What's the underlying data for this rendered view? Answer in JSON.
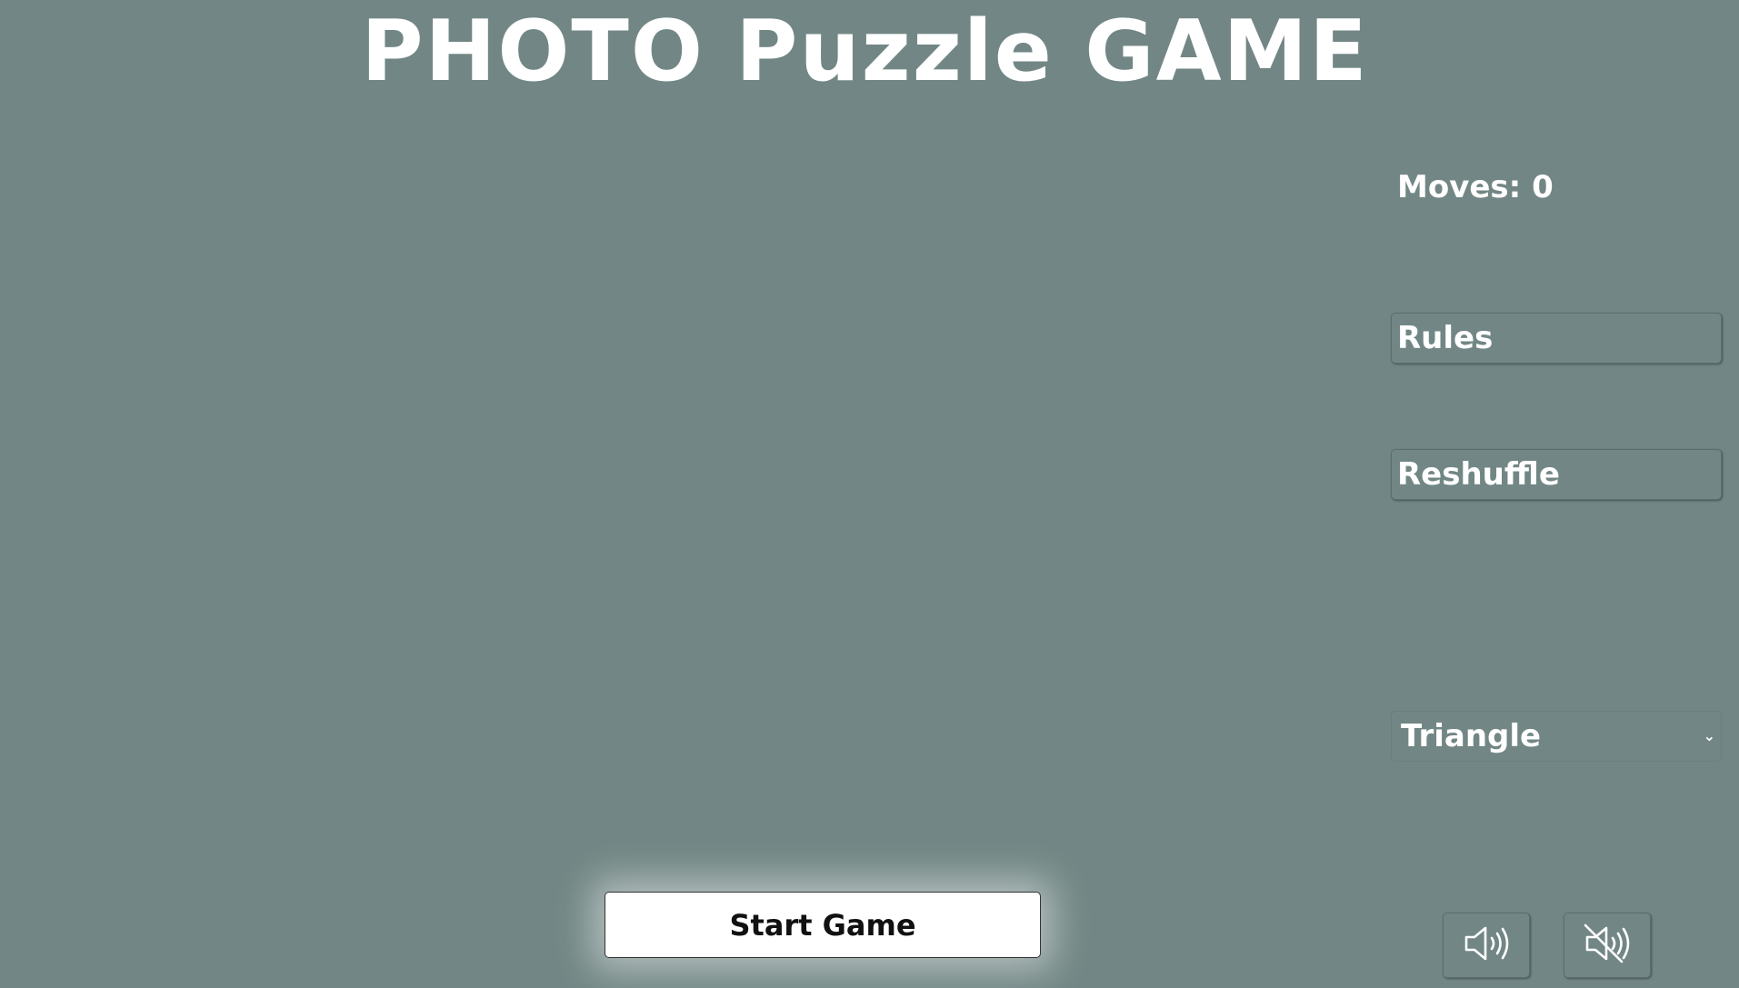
{
  "header": {
    "title": "PHOTO Puzzle GAME"
  },
  "sidebar": {
    "moves_label": "Moves: 0",
    "rules_label": "Rules",
    "reshuffle_label": "Reshuffle",
    "shape_select": {
      "selected": "Triangle"
    }
  },
  "footer": {
    "start_label": "Start Game",
    "sound_on_icon": "speaker-on-icon",
    "sound_off_icon": "speaker-muted-icon"
  },
  "colors": {
    "background": "#728785",
    "text": "#ffffff",
    "start_button_bg": "#ffffff"
  }
}
